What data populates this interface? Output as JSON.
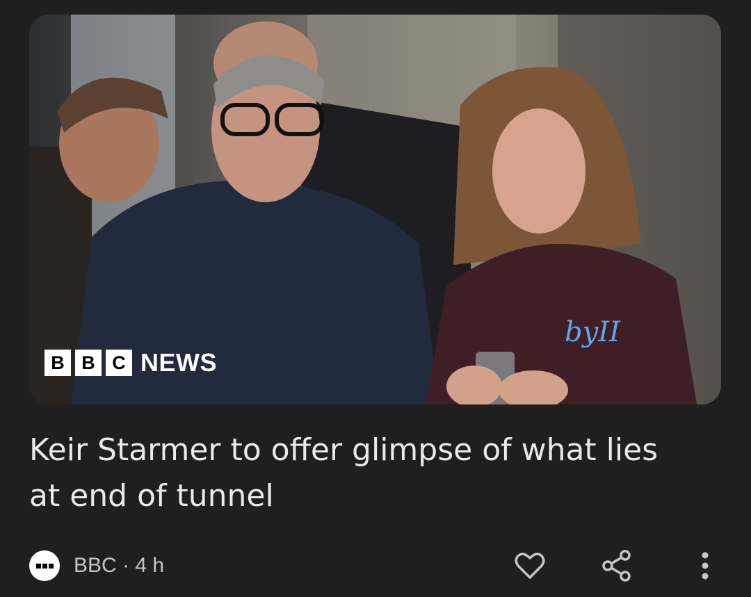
{
  "article": {
    "headline": "Keir Starmer to offer glimpse of what lies at end of tunnel",
    "image_logo": {
      "blocks": [
        "B",
        "B",
        "C"
      ],
      "word": "NEWS"
    },
    "shirt_logo": "byII"
  },
  "meta": {
    "source": "BBC",
    "separator": "·",
    "time": "4 h"
  },
  "actions": {
    "like_icon": "heart-icon",
    "share_icon": "share-icon",
    "more_icon": "more-vert-icon"
  },
  "colors": {
    "background": "#1f1f1f",
    "headline": "#e8eaed",
    "meta_text": "#c4c7c5",
    "icon": "#c4c7c5"
  }
}
